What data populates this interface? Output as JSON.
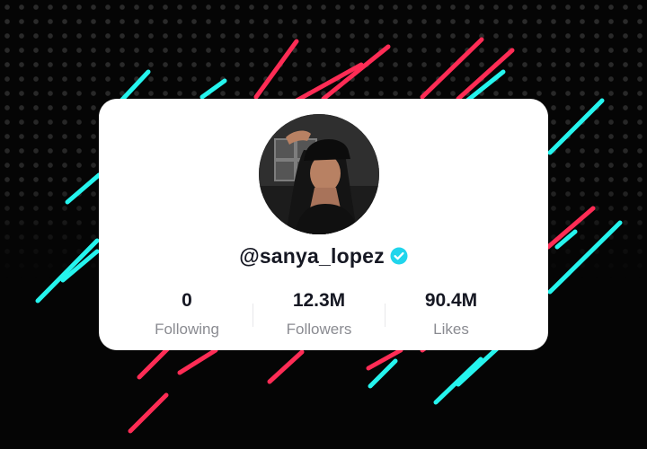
{
  "profile": {
    "handle": "@sanya_lopez",
    "verified": true,
    "avatar_alt": "profile photo"
  },
  "stats": [
    {
      "value": "0",
      "label": "Following"
    },
    {
      "value": "12.3M",
      "label": "Followers"
    },
    {
      "value": "90.4M",
      "label": "Likes"
    }
  ],
  "icons": {
    "verified": "verified-badge-icon"
  },
  "colors": {
    "background": "#050505",
    "accent_cyan": "#25f4ee",
    "accent_red": "#fe2c55",
    "verified_blue": "#20d5ec",
    "text_primary": "#161823",
    "text_secondary": "#8a8b91"
  }
}
